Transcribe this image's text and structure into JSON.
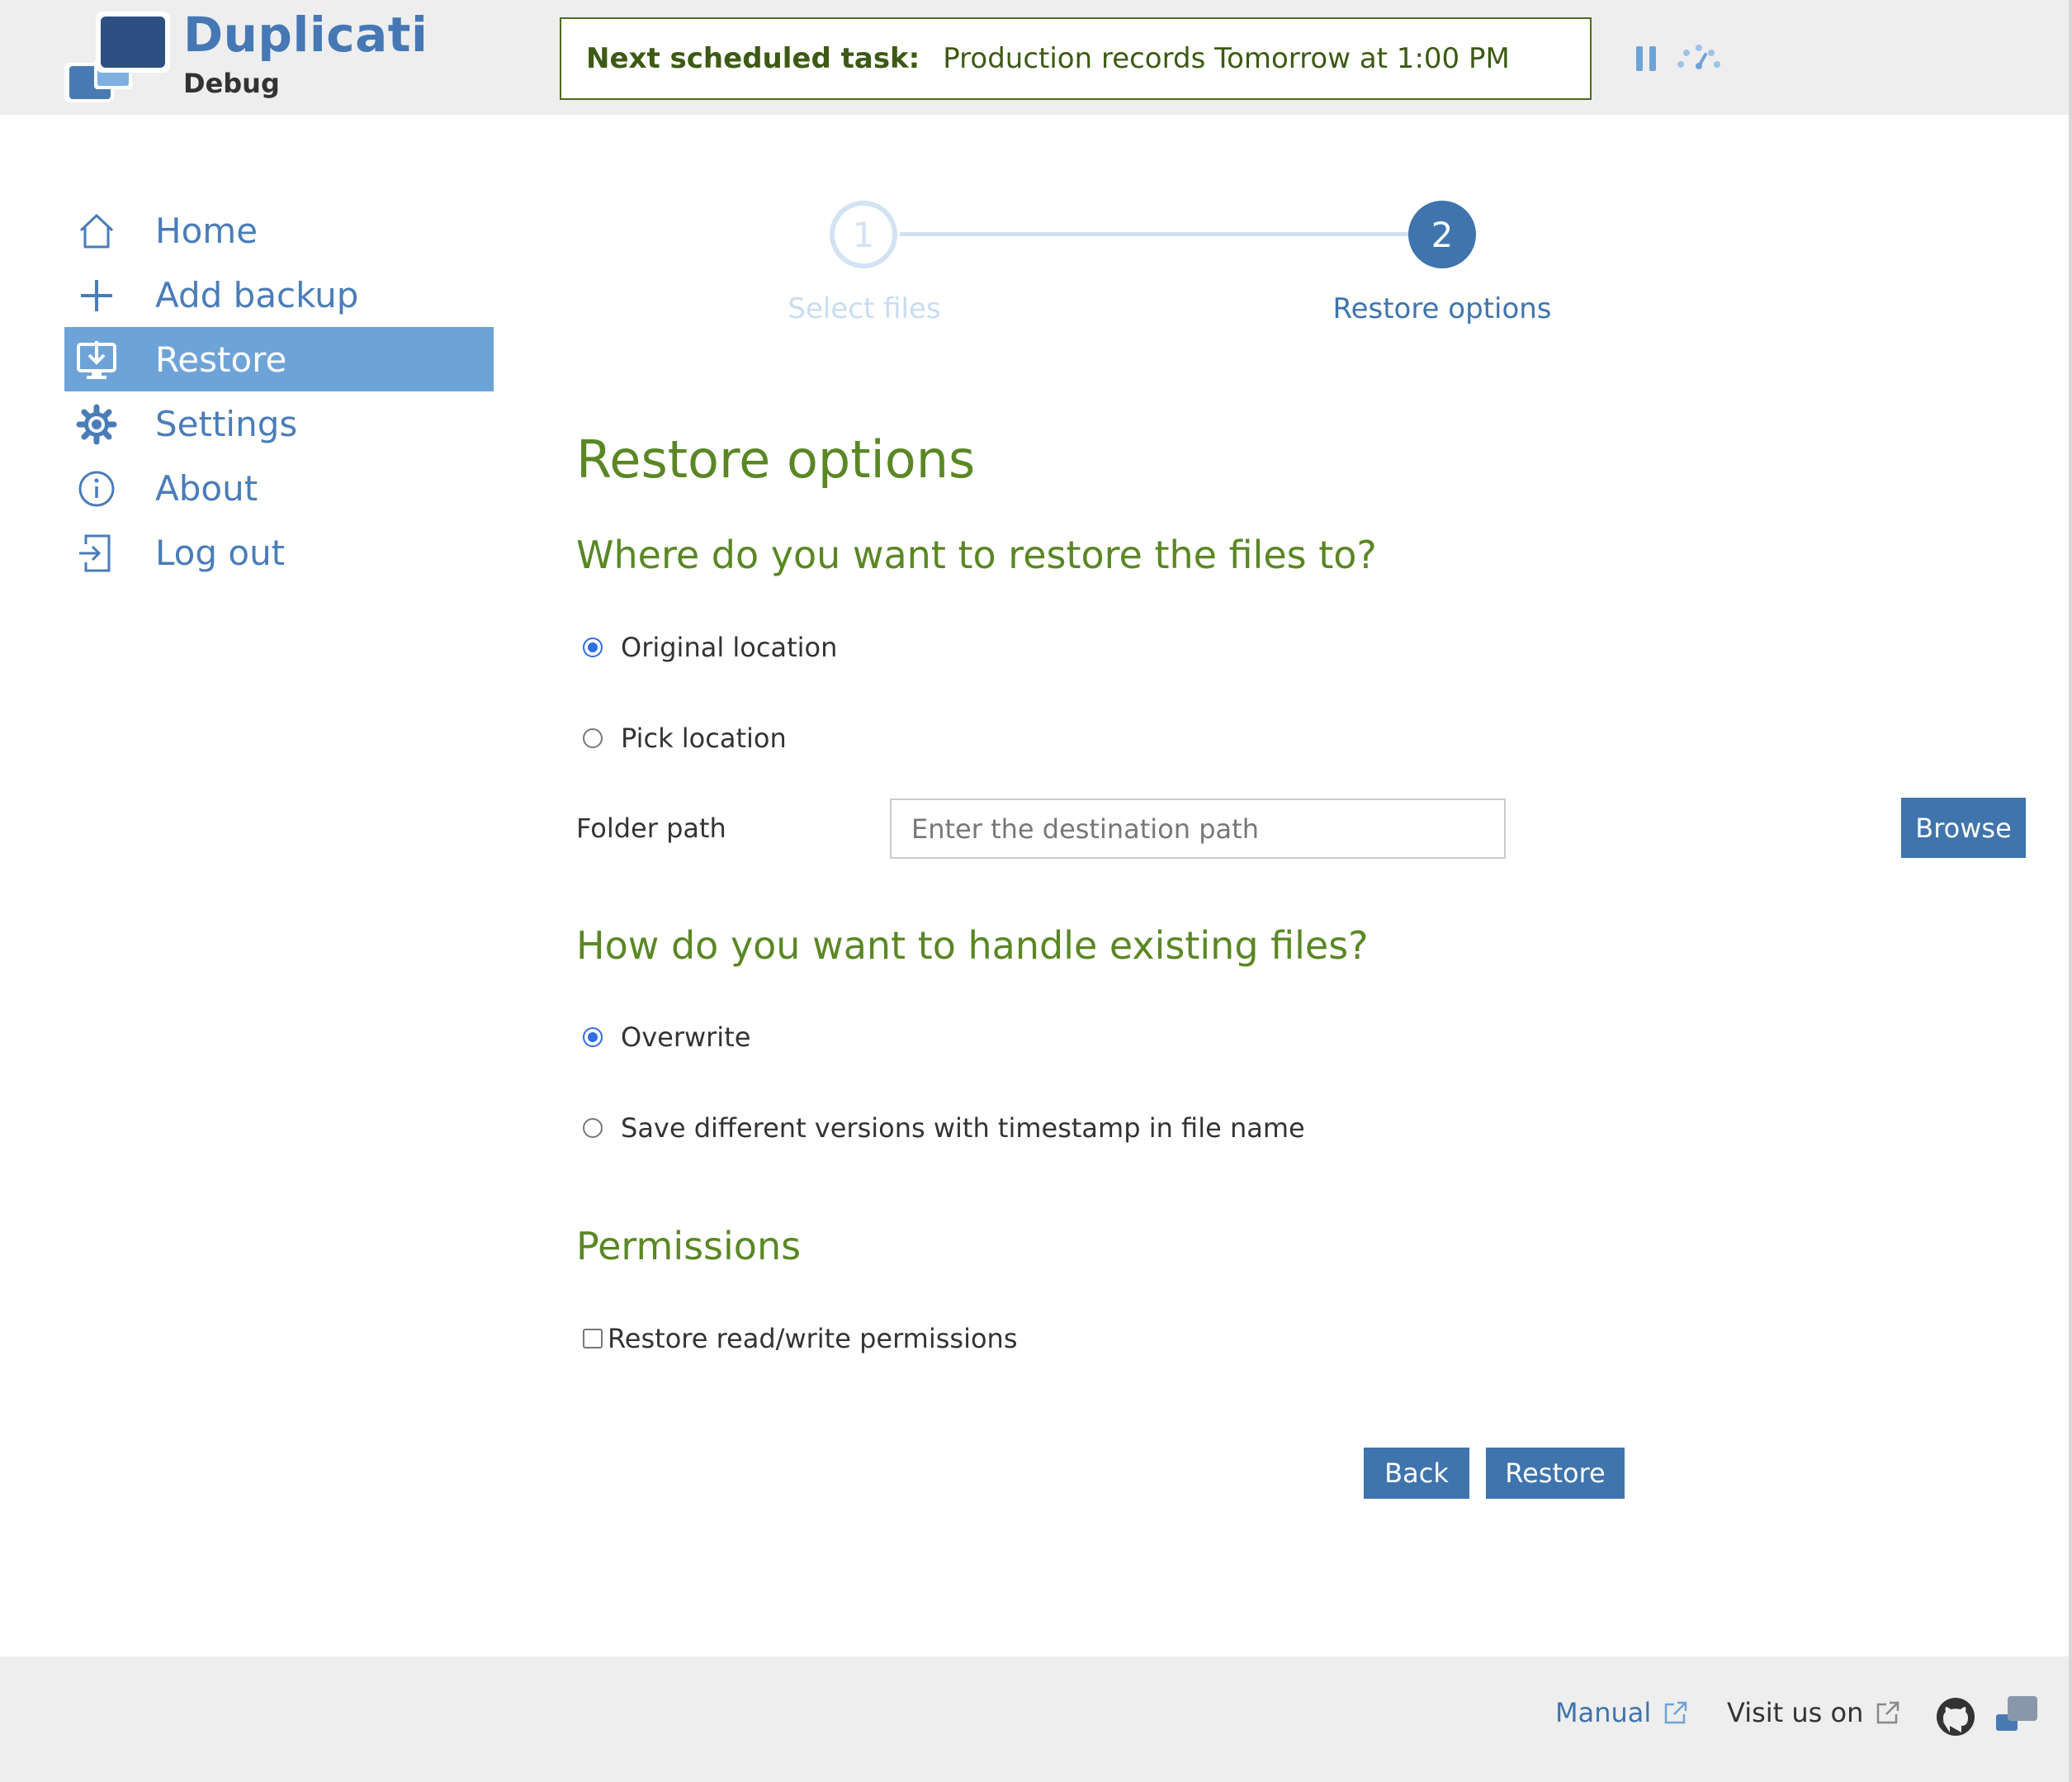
{
  "header": {
    "app_name": "Duplicati",
    "app_subtitle": "Debug",
    "next_task_label": "Next scheduled task:",
    "next_task_text": "Production records Tomorrow at 1:00 PM"
  },
  "sidebar": {
    "items": [
      {
        "label": "Home",
        "icon": "home-icon",
        "active": false
      },
      {
        "label": "Add backup",
        "icon": "plus-icon",
        "active": false
      },
      {
        "label": "Restore",
        "icon": "restore-monitor-icon",
        "active": true
      },
      {
        "label": "Settings",
        "icon": "gear-icon",
        "active": false
      },
      {
        "label": "About",
        "icon": "info-icon",
        "active": false
      },
      {
        "label": "Log out",
        "icon": "logout-icon",
        "active": false
      }
    ]
  },
  "wizard": {
    "steps": [
      {
        "number": "1",
        "label": "Select files",
        "state": "inactive"
      },
      {
        "number": "2",
        "label": "Restore options",
        "state": "active"
      }
    ]
  },
  "main": {
    "title": "Restore options",
    "location_heading": "Where do you want to restore the files to?",
    "location_options": [
      {
        "label": "Original location",
        "checked": true
      },
      {
        "label": "Pick location",
        "checked": false
      }
    ],
    "folder_path_label": "Folder path",
    "folder_path_placeholder": "Enter the destination path",
    "folder_path_value": "",
    "browse_label": "Browse",
    "existing_heading": "How do you want to handle existing files?",
    "existing_options": [
      {
        "label": "Overwrite",
        "checked": true
      },
      {
        "label": "Save different versions with timestamp in file name",
        "checked": false
      }
    ],
    "permissions_heading": "Permissions",
    "permissions_checkbox_label": "Restore read/write permissions",
    "permissions_checked": false,
    "back_label": "Back",
    "restore_label": "Restore"
  },
  "footer": {
    "manual_label": "Manual",
    "visit_label": "Visit us on"
  },
  "colors": {
    "brand_blue": "#4578b4",
    "accent_blue": "#3f74ad",
    "active_nav_bg": "#6ea3d8",
    "heading_green": "#5a8724",
    "task_green": "#3d5a14"
  }
}
